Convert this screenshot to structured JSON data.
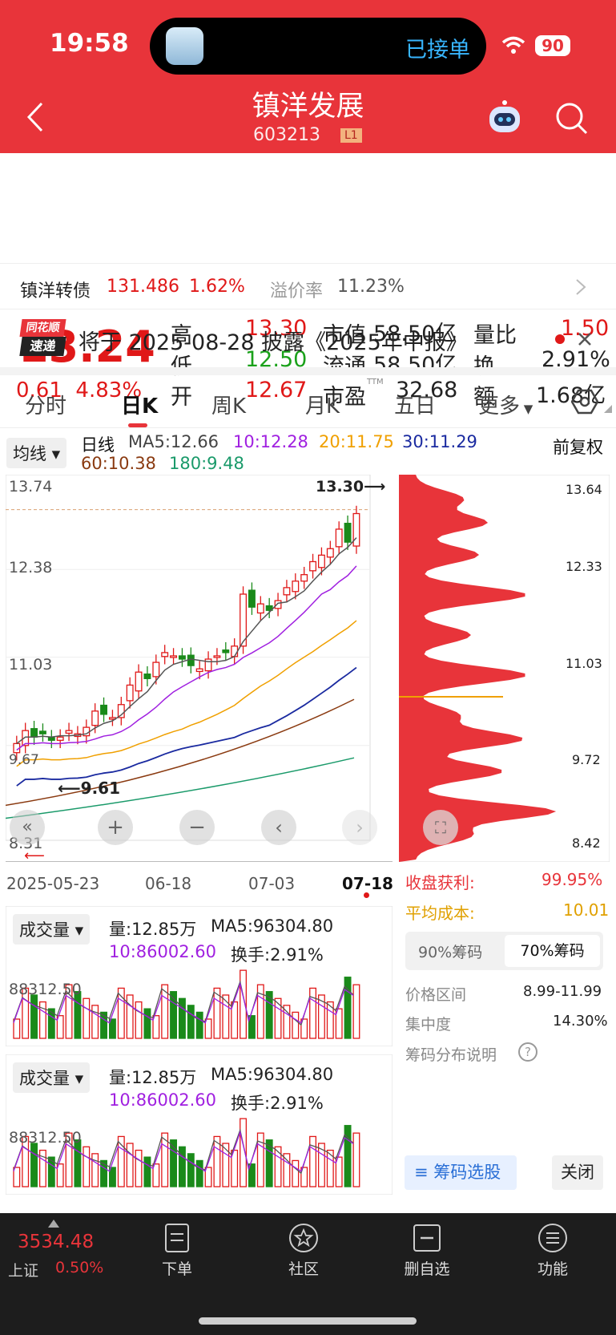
{
  "status": {
    "time": "19:58",
    "island_text": "已接单",
    "battery": "90"
  },
  "header": {
    "title": "镇洋发展",
    "code": "603213",
    "level": "L1"
  },
  "quote": {
    "price": "13.24",
    "change": "0.61",
    "change_pct": "4.83%",
    "high_label": "高",
    "high": "13.30",
    "low_label": "低",
    "low": "12.50",
    "open_label": "开",
    "open": "12.67",
    "mcap_label": "市值",
    "mcap": "58.50亿",
    "float_label": "流通",
    "float": "58.50亿",
    "pe_label": "市盈",
    "pe_sup": "TTM",
    "pe": "32.68",
    "vr_label": "量比",
    "vr": "1.50",
    "turn_label": "换",
    "turn": "2.91%",
    "amt_label": "额",
    "amt": "1.68亿"
  },
  "bond": {
    "name": "镇洋转债",
    "price": "131.486",
    "pct": "1.62%",
    "prem_label": "溢价率",
    "prem": "11.23%"
  },
  "notice": {
    "logo1": "同花顺",
    "logo2": "速递",
    "text": "将于 2025-08-28 披露《2025年中报》"
  },
  "tabs": [
    "分时",
    "日K",
    "周K",
    "月K",
    "五日",
    "更多"
  ],
  "kline": {
    "ma_btn": "均线",
    "period": "日线",
    "ma5": "MA5:12.66",
    "ma10": "10:12.28",
    "ma20": "20:11.75",
    "ma30": "30:11.29",
    "ma60": "60:10.38",
    "ma180": "180:9.48",
    "adjust": "前复权",
    "y_labels": [
      "13.74",
      "12.38",
      "11.03",
      "9.67",
      "8.31"
    ],
    "max_note": "13.30",
    "min_note": "9.61",
    "dates": [
      "2025-05-23",
      "06-18",
      "07-03",
      "07-18"
    ],
    "chip_labels": [
      "13.64",
      "12.33",
      "11.03",
      "9.72",
      "8.42"
    ]
  },
  "chip": {
    "profit_label": "收盘获利:",
    "profit": "99.95%",
    "cost_label": "平均成本:",
    "cost": "10.01",
    "tab90": "90%筹码",
    "tab70": "70%筹码",
    "range_label": "价格区间",
    "range": "8.99-11.99",
    "conc_label": "集中度",
    "conc": "14.30%",
    "explain": "筹码分布说明",
    "select": "筹码选股",
    "close": "关闭"
  },
  "volume": {
    "btn": "成交量",
    "vol": "量:12.85万",
    "ma5": "MA5:96304.80",
    "ma10": "10:86002.60",
    "turn": "换手:2.91%",
    "ylab": "88312.50"
  },
  "bottom": {
    "index": "3534.48",
    "index_name": "上证",
    "index_pct": "0.50%",
    "items": [
      "下单",
      "社区",
      "删自选",
      "功能"
    ]
  },
  "colors": {
    "brand": "#e8343a",
    "up": "#e01818",
    "down": "#1a8a1a"
  },
  "chart_data": {
    "type": "candlestick",
    "title": "日K",
    "ylim": [
      8.31,
      13.74
    ],
    "x_range": [
      "2025-05-23",
      "07-18"
    ],
    "series": [
      {
        "name": "MA5",
        "last": 12.66
      },
      {
        "name": "MA10",
        "last": 12.28
      },
      {
        "name": "MA20",
        "last": 11.75
      },
      {
        "name": "MA30",
        "last": 11.29
      },
      {
        "name": "MA60",
        "last": 10.38
      },
      {
        "name": "MA180",
        "last": 9.48
      }
    ],
    "closes": [
      9.7,
      9.9,
      9.8,
      9.85,
      9.75,
      9.8,
      9.9,
      9.85,
      9.95,
      10.2,
      10.15,
      10.1,
      10.3,
      10.6,
      10.8,
      10.7,
      10.95,
      11.1,
      11.05,
      11.0,
      10.9,
      10.85,
      11.0,
      11.05,
      11.1,
      11.2,
      12.0,
      11.8,
      11.85,
      11.75,
      11.9,
      12.1,
      12.2,
      12.3,
      12.5,
      12.6,
      12.7,
      13.0,
      12.8,
      13.24
    ],
    "volume_ylabel": "88312.50"
  }
}
